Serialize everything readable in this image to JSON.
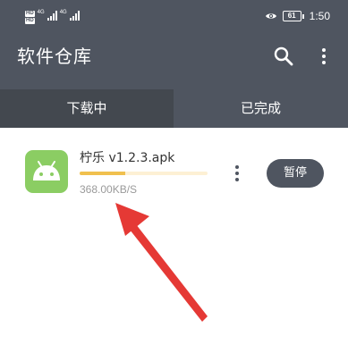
{
  "status_bar": {
    "hd_labels": [
      "HD",
      "HD"
    ],
    "network_labels": [
      "4G",
      "4G"
    ],
    "battery": "61",
    "time": "1:50"
  },
  "app_bar": {
    "title": "软件仓库",
    "actions": [
      "search-icon",
      "more-vert-icon"
    ]
  },
  "tabs": [
    {
      "label": "下载中",
      "selected": true
    },
    {
      "label": "已完成",
      "selected": false
    }
  ],
  "downloads": [
    {
      "icon": "android-icon",
      "name": "柠乐 v1.2.3.apk",
      "progress": 0.36,
      "speed": "368.00KB/S",
      "action_label": "暂停"
    }
  ],
  "colors": {
    "header": "#4f5560",
    "selected_tab": "#43484f",
    "android_icon_bg": "#8bcd63",
    "progress": "#f0c04e",
    "annotation_arrow": "#e53935"
  }
}
